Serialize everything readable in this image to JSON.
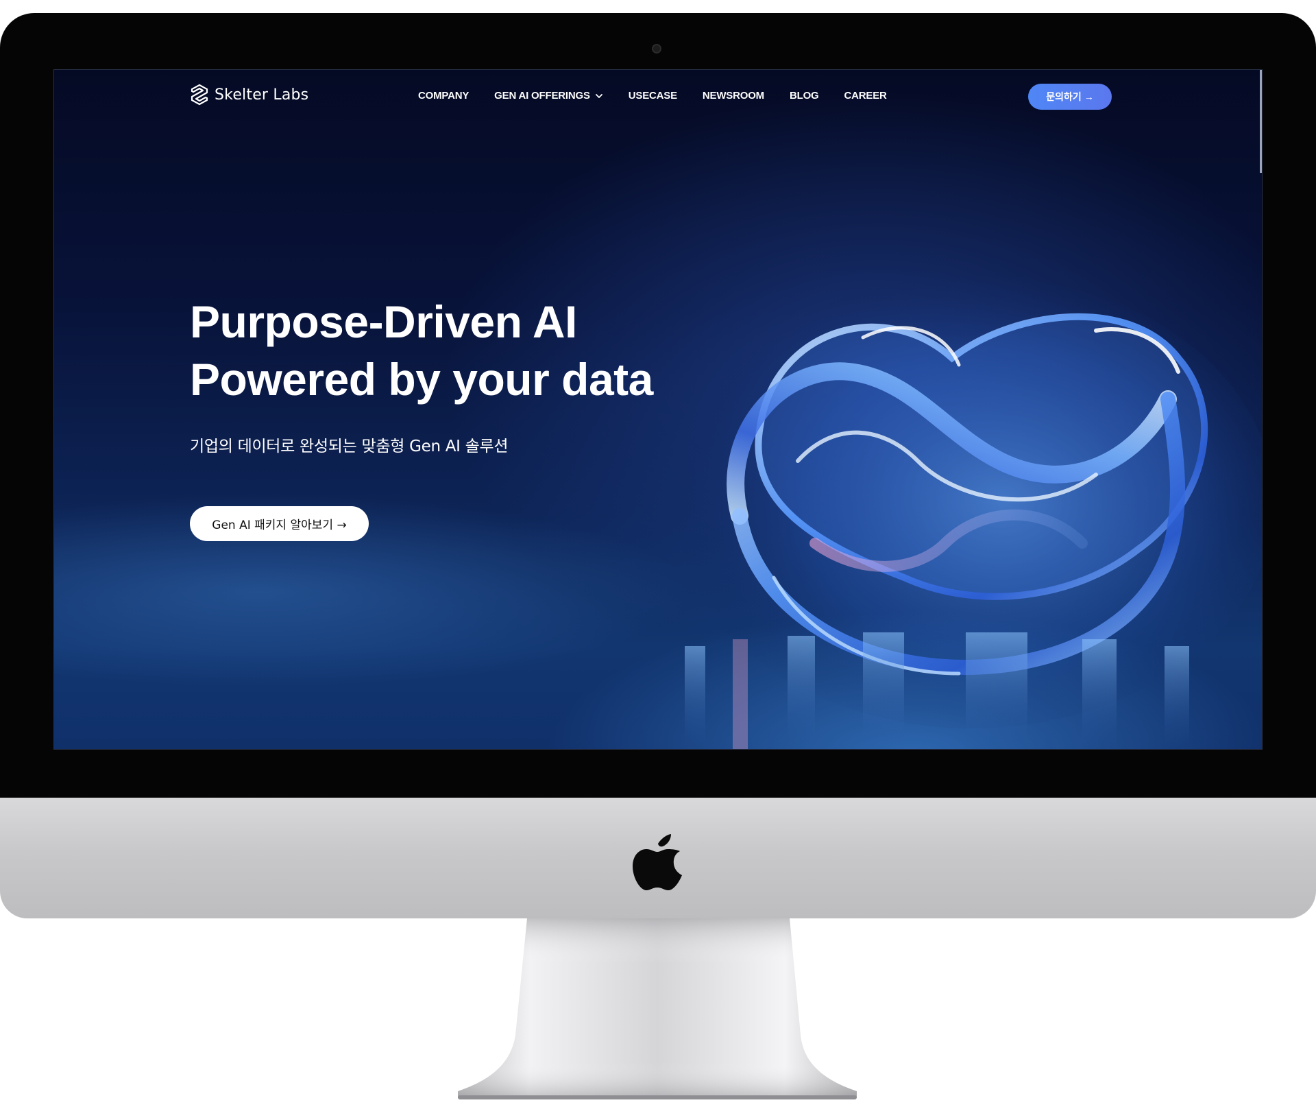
{
  "device": {
    "name": "iMac",
    "bezel_color": "#050505",
    "chin_color": "#c8c8ca",
    "logo_icon": "apple-icon"
  },
  "site": {
    "brand": {
      "name": "Skelter Labs",
      "logo_icon": "skelter-labs-logo-icon"
    },
    "nav": {
      "items": [
        {
          "label": "COMPANY",
          "has_dropdown": false
        },
        {
          "label": "GEN AI OFFERINGS",
          "has_dropdown": true
        },
        {
          "label": "USECASE",
          "has_dropdown": false
        },
        {
          "label": "NEWSROOM",
          "has_dropdown": false
        },
        {
          "label": "BLOG",
          "has_dropdown": false
        },
        {
          "label": "CAREER",
          "has_dropdown": false
        }
      ],
      "contact_label": "문의하기 →",
      "contact_color": "#4f86f5"
    },
    "hero": {
      "title_line1": "Purpose-Driven AI",
      "title_line2": "Powered by your data",
      "subtitle": "기업의 데이터로 완성되는 맞춤형 Gen AI 솔루션",
      "cta_label": "Gen AI 패키지 알아보기 →",
      "art": "glass-knot-3d-illustration"
    },
    "colors": {
      "background_top": "#050a24",
      "background_bottom": "#10306a",
      "accent": "#4f86f5",
      "text": "#ffffff"
    }
  }
}
